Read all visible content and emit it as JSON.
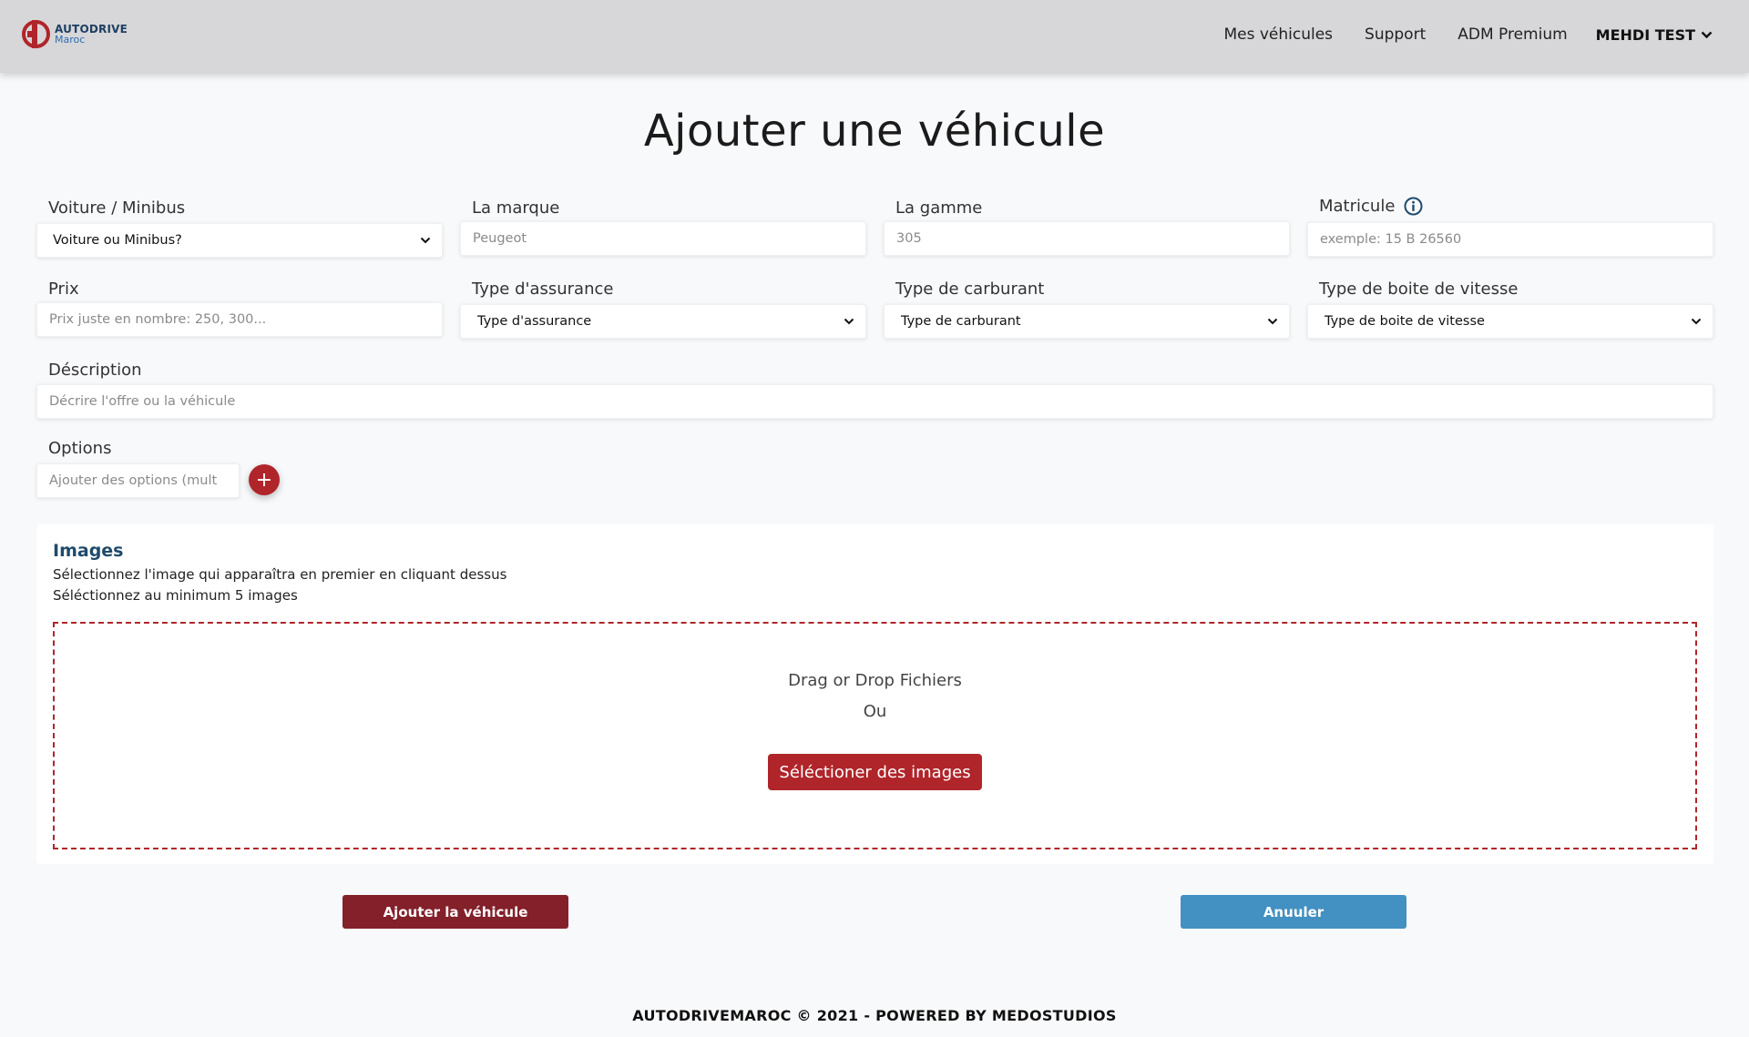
{
  "header": {
    "brand": "AUTODRIVE",
    "brand_sub": "Maroc",
    "nav": [
      "Mes véhicules",
      "Support",
      "ADM Premium"
    ],
    "user": "MEHDI TEST"
  },
  "page": {
    "title": "Ajouter une véhicule"
  },
  "form": {
    "type": {
      "label": "Voiture / Minibus",
      "value": "Voiture ou Minibus?"
    },
    "marque": {
      "label": "La marque",
      "placeholder": "Peugeot"
    },
    "gamme": {
      "label": "La gamme",
      "placeholder": "305"
    },
    "matricule": {
      "label": "Matricule",
      "placeholder": "exemple: 15 B 26560"
    },
    "prix": {
      "label": "Prix",
      "placeholder": "Prix juste en nombre: 250, 300..."
    },
    "assurance": {
      "label": "Type d'assurance",
      "value": "Type d'assurance"
    },
    "carburant": {
      "label": "Type de carburant",
      "value": "Type de carburant"
    },
    "boite": {
      "label": "Type de boite de vitesse",
      "value": "Type de boite de vitesse"
    },
    "description": {
      "label": "Déscription",
      "placeholder": "Décrire l'offre ou la véhicule"
    },
    "options": {
      "label": "Options",
      "placeholder": "Ajouter des options (mult",
      "add_symbol": "+"
    }
  },
  "images": {
    "title": "Images",
    "hint1": "Sélectionnez l'image qui apparaîtra en premier en cliquant dessus",
    "hint2": "Séléctionnez au minimum 5 images",
    "drop_text": "Drag or Drop Fichiers",
    "or_text": "Ou",
    "select_button": "Séléctioner des images"
  },
  "actions": {
    "add": "Ajouter la véhicule",
    "cancel": "Anuuler"
  },
  "footer": {
    "text": "AUTODRIVEMAROC © 2021 - POWERED BY MEDOSTUDIOS"
  },
  "colors": {
    "accent": "#b0252a",
    "dark_red": "#83202a",
    "blue": "#4390c2",
    "navbar": "#d7d6d8",
    "title_blue": "#1f4a6b"
  }
}
